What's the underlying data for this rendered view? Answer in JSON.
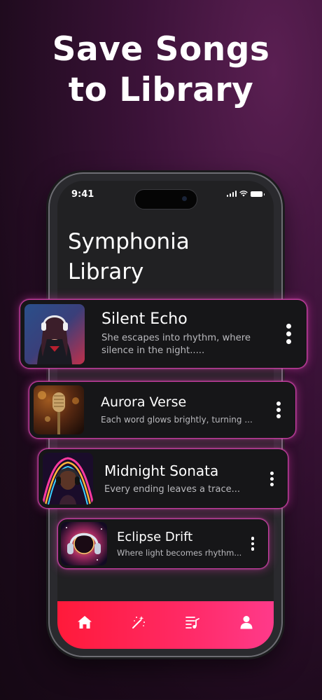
{
  "headline": {
    "line1": "Save Songs",
    "line2": "to Library"
  },
  "status_bar": {
    "time": "9:41",
    "icons": [
      "signal-icon",
      "wifi-icon",
      "battery-icon"
    ]
  },
  "app": {
    "title_line1": "Symphonia",
    "title_line2": "Library"
  },
  "songs": [
    {
      "title": "Silent Echo",
      "description": "She escapes into rhythm, where silence in the night.....",
      "art": "woman-headphones-art"
    },
    {
      "title": "Aurora Verse",
      "description": "Each word glows brightly, turning ...",
      "art": "microphone-art"
    },
    {
      "title": "Midnight Sonata",
      "description": "Every ending leaves a trace...",
      "art": "neon-portrait-art"
    },
    {
      "title": "Eclipse Drift",
      "description": "Where light becomes rhythm...",
      "art": "cosmic-headphones-art"
    }
  ],
  "bottom_nav": {
    "items": [
      "home-icon",
      "magic-wand-icon",
      "playlist-icon",
      "profile-icon"
    ],
    "gradient": [
      "#ff1a3a",
      "#ff3a8a"
    ]
  },
  "colors": {
    "card_glow": "#c63aa0",
    "screen_bg": "#212123",
    "page_bg": "#3b1238"
  }
}
